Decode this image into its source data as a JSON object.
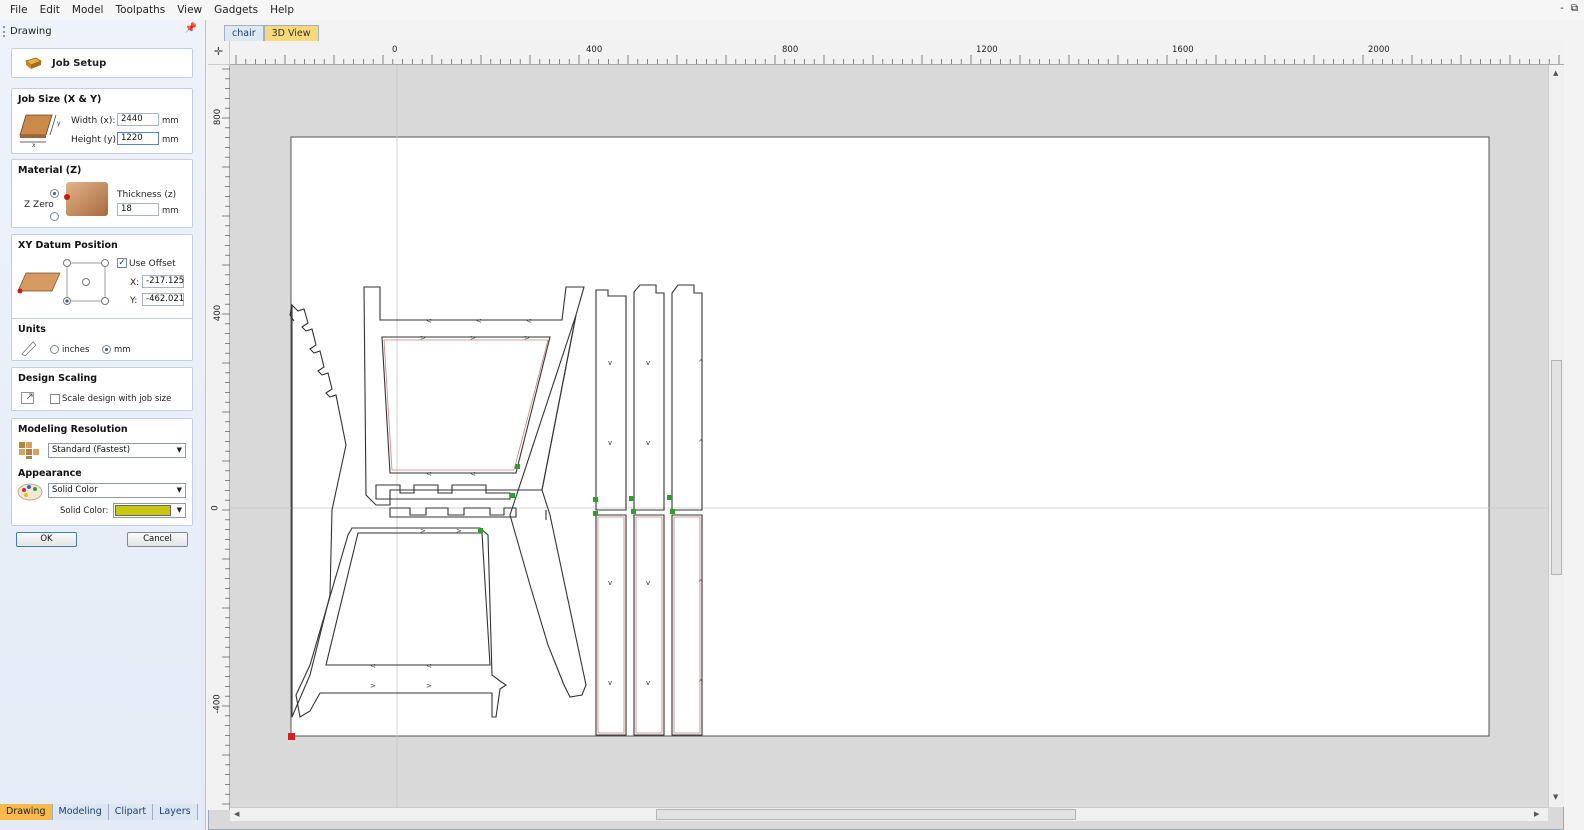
{
  "menu": {
    "items": [
      "File",
      "Edit",
      "Model",
      "Toolpaths",
      "View",
      "Gadgets",
      "Help"
    ],
    "window_controls": "- ⧉"
  },
  "panel": {
    "title": "Drawing",
    "pin_icon": "pin-icon",
    "job_setup_label": "Job Setup",
    "job_size": {
      "title": "Job Size (X & Y)",
      "width_label": "Width (x):",
      "width_value": "2440",
      "height_label": "Height (y):",
      "height_value": "1220",
      "unit": "mm"
    },
    "material": {
      "title": "Material (Z)",
      "zzero_label": "Z Zero",
      "thickness_label": "Thickness (z)",
      "thickness_value": "18",
      "unit": "mm"
    },
    "datum": {
      "title": "XY Datum Position",
      "use_offset_label": "Use Offset",
      "x_label": "X:",
      "x_value": "-217.125",
      "y_label": "Y:",
      "y_value": "-462.021"
    },
    "units": {
      "title": "Units",
      "inches_label": "inches",
      "mm_label": "mm"
    },
    "scaling": {
      "title": "Design Scaling",
      "scale_label": "Scale design with job size"
    },
    "resolution": {
      "title": "Modeling Resolution",
      "value": "Standard (Fastest)"
    },
    "appearance": {
      "title": "Appearance",
      "value": "Solid Color",
      "solid_color_label": "Solid Color:",
      "solid_color": "#c8c814"
    },
    "ok_label": "OK",
    "cancel_label": "Cancel"
  },
  "bottom_tabs": [
    "Drawing",
    "Modeling",
    "Clipart",
    "Layers"
  ],
  "doc_tabs": [
    "chair",
    "3D View"
  ],
  "rulers": {
    "h_labels": [
      "0",
      "400",
      "800",
      "1200",
      "1600",
      "2000"
    ],
    "v_labels": [
      "800",
      "400",
      "0",
      "-400"
    ]
  },
  "colors": {
    "accent_tab": "#f7b94a",
    "vector_line": "#333333",
    "node_green": "#2ea02e",
    "origin_red": "#d42020"
  }
}
